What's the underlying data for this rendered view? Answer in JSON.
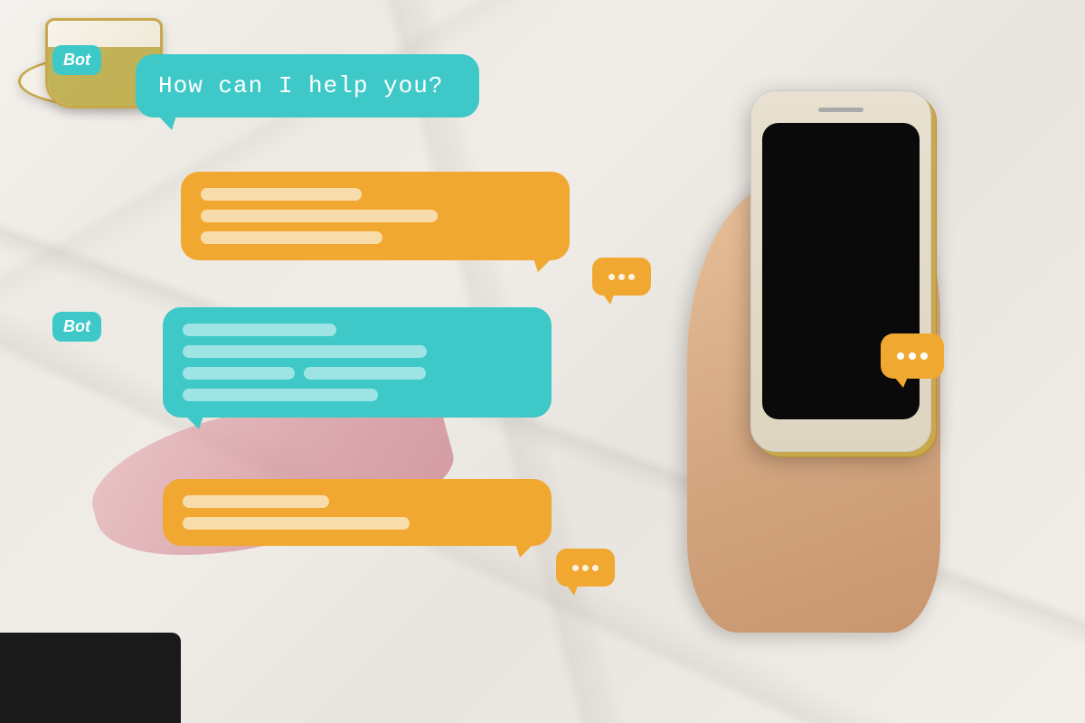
{
  "background": {
    "color": "#ede9e4",
    "description": "marble surface"
  },
  "chat": {
    "bot_label": "Bot",
    "bot_label_2": "Bot",
    "bot_bubble_1_text": "How can I help you?",
    "user_bubble_1_lines": [
      {
        "width": "45%"
      },
      {
        "width": "70%"
      },
      {
        "width": "55%"
      }
    ],
    "bot_bubble_2_lines": [
      {
        "width": "45%"
      },
      {
        "width": "70%"
      },
      {
        "width": "35%"
      },
      {
        "width": "55%"
      }
    ],
    "user_bubble_2_lines": [
      {
        "width": "42%"
      },
      {
        "width": "68%"
      }
    ],
    "typing_dots": "···"
  },
  "colors": {
    "teal": "#3ec8c8",
    "amber": "#f0a830",
    "white_text": "#ffffff",
    "marble": "#ede9e4",
    "gold": "#c8a84b"
  },
  "phone": {
    "screen_color": "#0a0a0a"
  }
}
